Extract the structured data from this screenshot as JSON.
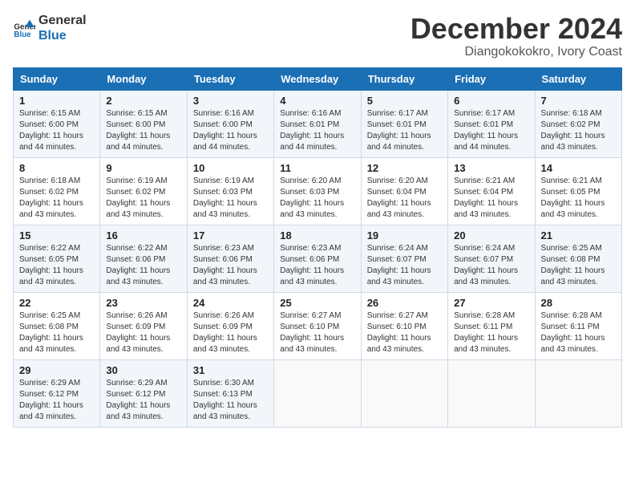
{
  "logo": {
    "line1": "General",
    "line2": "Blue"
  },
  "title": "December 2024",
  "location": "Diangokokokro, Ivory Coast",
  "days_of_week": [
    "Sunday",
    "Monday",
    "Tuesday",
    "Wednesday",
    "Thursday",
    "Friday",
    "Saturday"
  ],
  "weeks": [
    [
      {
        "day": "1",
        "sunrise": "6:15 AM",
        "sunset": "6:00 PM",
        "daylight": "11 hours and 44 minutes."
      },
      {
        "day": "2",
        "sunrise": "6:15 AM",
        "sunset": "6:00 PM",
        "daylight": "11 hours and 44 minutes."
      },
      {
        "day": "3",
        "sunrise": "6:16 AM",
        "sunset": "6:00 PM",
        "daylight": "11 hours and 44 minutes."
      },
      {
        "day": "4",
        "sunrise": "6:16 AM",
        "sunset": "6:01 PM",
        "daylight": "11 hours and 44 minutes."
      },
      {
        "day": "5",
        "sunrise": "6:17 AM",
        "sunset": "6:01 PM",
        "daylight": "11 hours and 44 minutes."
      },
      {
        "day": "6",
        "sunrise": "6:17 AM",
        "sunset": "6:01 PM",
        "daylight": "11 hours and 44 minutes."
      },
      {
        "day": "7",
        "sunrise": "6:18 AM",
        "sunset": "6:02 PM",
        "daylight": "11 hours and 43 minutes."
      }
    ],
    [
      {
        "day": "8",
        "sunrise": "6:18 AM",
        "sunset": "6:02 PM",
        "daylight": "11 hours and 43 minutes."
      },
      {
        "day": "9",
        "sunrise": "6:19 AM",
        "sunset": "6:02 PM",
        "daylight": "11 hours and 43 minutes."
      },
      {
        "day": "10",
        "sunrise": "6:19 AM",
        "sunset": "6:03 PM",
        "daylight": "11 hours and 43 minutes."
      },
      {
        "day": "11",
        "sunrise": "6:20 AM",
        "sunset": "6:03 PM",
        "daylight": "11 hours and 43 minutes."
      },
      {
        "day": "12",
        "sunrise": "6:20 AM",
        "sunset": "6:04 PM",
        "daylight": "11 hours and 43 minutes."
      },
      {
        "day": "13",
        "sunrise": "6:21 AM",
        "sunset": "6:04 PM",
        "daylight": "11 hours and 43 minutes."
      },
      {
        "day": "14",
        "sunrise": "6:21 AM",
        "sunset": "6:05 PM",
        "daylight": "11 hours and 43 minutes."
      }
    ],
    [
      {
        "day": "15",
        "sunrise": "6:22 AM",
        "sunset": "6:05 PM",
        "daylight": "11 hours and 43 minutes."
      },
      {
        "day": "16",
        "sunrise": "6:22 AM",
        "sunset": "6:06 PM",
        "daylight": "11 hours and 43 minutes."
      },
      {
        "day": "17",
        "sunrise": "6:23 AM",
        "sunset": "6:06 PM",
        "daylight": "11 hours and 43 minutes."
      },
      {
        "day": "18",
        "sunrise": "6:23 AM",
        "sunset": "6:06 PM",
        "daylight": "11 hours and 43 minutes."
      },
      {
        "day": "19",
        "sunrise": "6:24 AM",
        "sunset": "6:07 PM",
        "daylight": "11 hours and 43 minutes."
      },
      {
        "day": "20",
        "sunrise": "6:24 AM",
        "sunset": "6:07 PM",
        "daylight": "11 hours and 43 minutes."
      },
      {
        "day": "21",
        "sunrise": "6:25 AM",
        "sunset": "6:08 PM",
        "daylight": "11 hours and 43 minutes."
      }
    ],
    [
      {
        "day": "22",
        "sunrise": "6:25 AM",
        "sunset": "6:08 PM",
        "daylight": "11 hours and 43 minutes."
      },
      {
        "day": "23",
        "sunrise": "6:26 AM",
        "sunset": "6:09 PM",
        "daylight": "11 hours and 43 minutes."
      },
      {
        "day": "24",
        "sunrise": "6:26 AM",
        "sunset": "6:09 PM",
        "daylight": "11 hours and 43 minutes."
      },
      {
        "day": "25",
        "sunrise": "6:27 AM",
        "sunset": "6:10 PM",
        "daylight": "11 hours and 43 minutes."
      },
      {
        "day": "26",
        "sunrise": "6:27 AM",
        "sunset": "6:10 PM",
        "daylight": "11 hours and 43 minutes."
      },
      {
        "day": "27",
        "sunrise": "6:28 AM",
        "sunset": "6:11 PM",
        "daylight": "11 hours and 43 minutes."
      },
      {
        "day": "28",
        "sunrise": "6:28 AM",
        "sunset": "6:11 PM",
        "daylight": "11 hours and 43 minutes."
      }
    ],
    [
      {
        "day": "29",
        "sunrise": "6:29 AM",
        "sunset": "6:12 PM",
        "daylight": "11 hours and 43 minutes."
      },
      {
        "day": "30",
        "sunrise": "6:29 AM",
        "sunset": "6:12 PM",
        "daylight": "11 hours and 43 minutes."
      },
      {
        "day": "31",
        "sunrise": "6:30 AM",
        "sunset": "6:13 PM",
        "daylight": "11 hours and 43 minutes."
      },
      null,
      null,
      null,
      null
    ]
  ]
}
